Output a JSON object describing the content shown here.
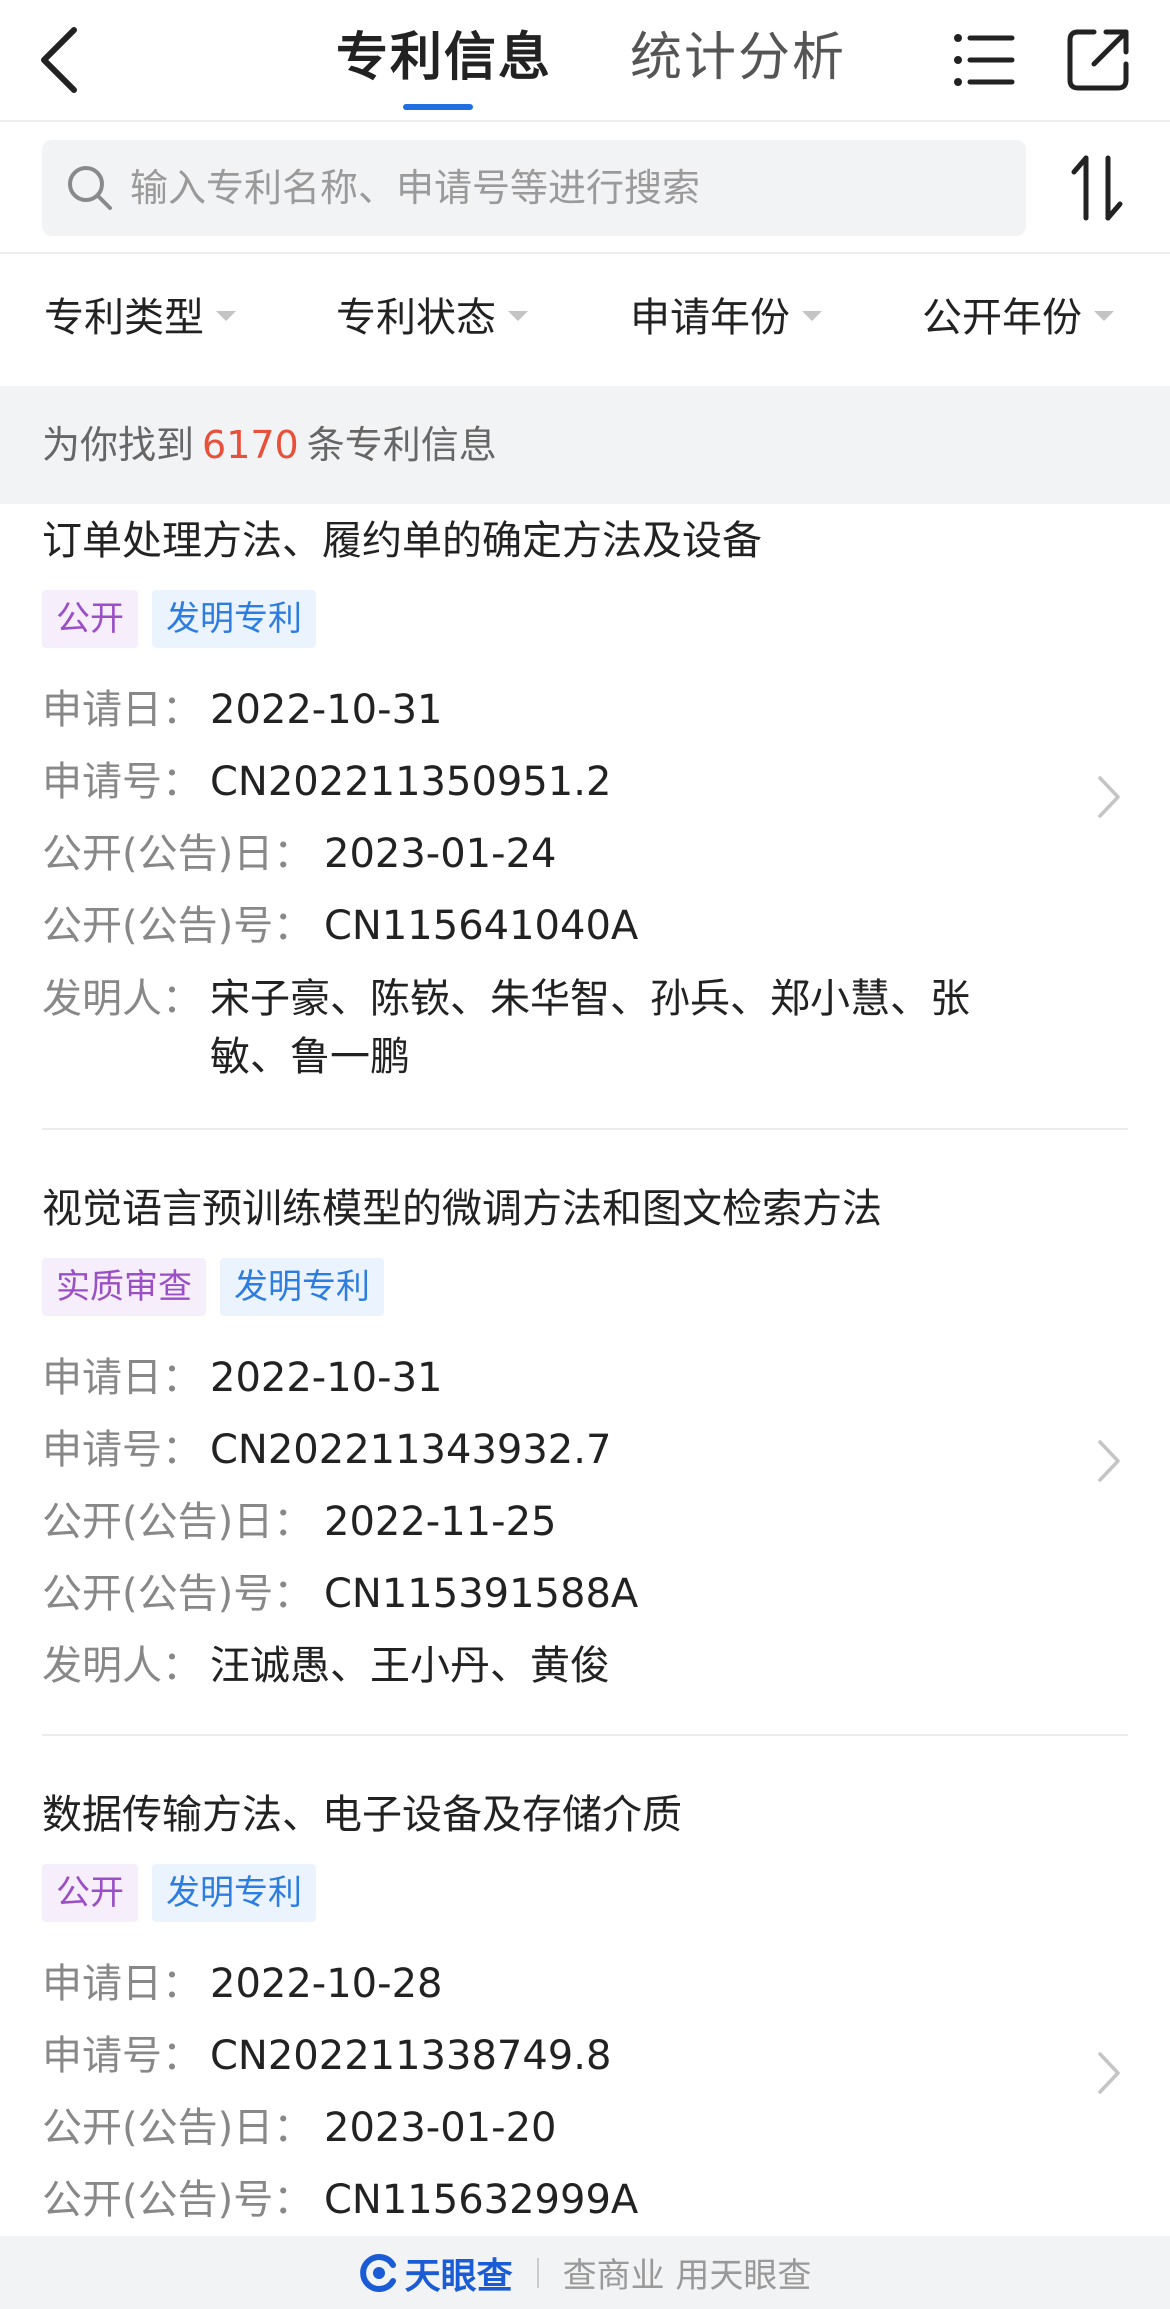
{
  "header": {
    "tabs": [
      {
        "label": "专利信息",
        "active": true
      },
      {
        "label": "统计分析",
        "active": false
      }
    ],
    "icons": {
      "back": "chevron-left-icon",
      "list": "list-icon",
      "share": "share-icon"
    },
    "accent": "#1f6fe0"
  },
  "search": {
    "placeholder": "输入专利名称、申请号等进行搜索",
    "value": "",
    "sort_icon": "sort-icon"
  },
  "filters": [
    {
      "label": "专利类型"
    },
    {
      "label": "专利状态"
    },
    {
      "label": "申请年份"
    },
    {
      "label": "公开年份"
    }
  ],
  "result": {
    "prefix": "为你找到",
    "count": "6170",
    "suffix": "条专利信息",
    "count_color": "#e8503a"
  },
  "labels": {
    "apply_date": "申请日：",
    "apply_no": "申请号：",
    "pub_date": "公开(公告)日：",
    "pub_no": "公开(公告)号：",
    "inventor": "发明人："
  },
  "patents": [
    {
      "title": "订单处理方法、履约单的确定方法及设备",
      "status": "公开",
      "type": "发明专利",
      "apply_date": "2022-10-31",
      "apply_no": "CN202211350951.2",
      "pub_date": "2023-01-24",
      "pub_no": "CN115641040A",
      "inventor": "宋子豪、陈嵚、朱华智、孙兵、郑小慧、张敏、鲁一鹏"
    },
    {
      "title": "视觉语言预训练模型的微调方法和图文检索方法",
      "status": "实质审查",
      "type": "发明专利",
      "apply_date": "2022-10-31",
      "apply_no": "CN202211343932.7",
      "pub_date": "2022-11-25",
      "pub_no": "CN115391588A",
      "inventor": "汪诚愚、王小丹、黄俊"
    },
    {
      "title": "数据传输方法、电子设备及存储介质",
      "status": "公开",
      "type": "发明专利",
      "apply_date": "2022-10-28",
      "apply_no": "CN202211338749.8",
      "pub_date": "2023-01-20",
      "pub_no": "CN115632999A"
    }
  ],
  "footer": {
    "brand": "天眼查",
    "slogan": "查商业 用天眼查",
    "brand_color": "#1a5bd6"
  }
}
